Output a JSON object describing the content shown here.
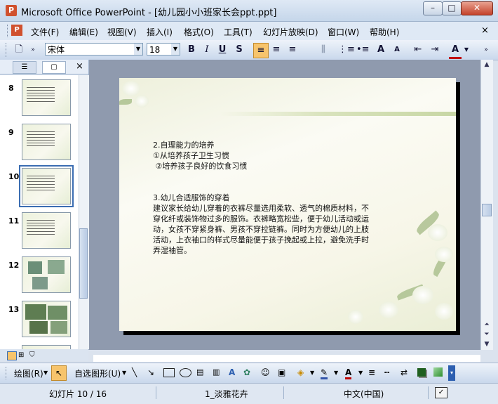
{
  "window": {
    "title": "Microsoft Office PowerPoint - [幼儿园小小班家长会ppt.ppt]",
    "min_label": "–",
    "max_label": "□",
    "close_label": "✕"
  },
  "menu": {
    "items": [
      "文件(F)",
      "编辑(E)",
      "视图(V)",
      "插入(I)",
      "格式(O)",
      "工具(T)",
      "幻灯片放映(D)",
      "窗口(W)",
      "帮助(H)"
    ],
    "close_label": "×"
  },
  "toolbar": {
    "font_name": "宋体",
    "font_size": "18",
    "bold_label": "B",
    "italic_label": "I",
    "underline_label": "U",
    "shadow_label": "S",
    "increase_font_label": "A",
    "decrease_font_label": "A",
    "font_color_label": "A"
  },
  "slides_panel": {
    "close_label": "×",
    "thumbnails": [
      {
        "number": "8"
      },
      {
        "number": "9"
      },
      {
        "number": "10"
      },
      {
        "number": "11"
      },
      {
        "number": "12"
      },
      {
        "number": "13"
      }
    ],
    "selected": "10"
  },
  "slide": {
    "heading1": "2.自理能力的培养",
    "item1": "①从培养孩子卫生习惯",
    "item2": " ②培养孩子良好的饮食习惯",
    "heading2": "3.幼儿合适服饰的穿着",
    "body": "建议家长给幼儿穿着的衣裤尽量选用柔软、透气的棉质材料，不穿化纤或装饰物过多的服饰。衣裤略宽松些，便于幼儿活动或运动，女孩不穿紧身裤、男孩不穿拉链裤。同时为方便幼儿的上肢活动，上衣袖口的样式尽量能便于孩子挽起或上拉，避免洗手时弄湿袖管。"
  },
  "drawing_toolbar": {
    "draw_label": "绘图(R)",
    "autoshapes_label": "自选图形(U)"
  },
  "status": {
    "slide_info": "幻灯片 10 / 16",
    "design": "1_淡雅花卉",
    "language": "中文(中国)"
  }
}
